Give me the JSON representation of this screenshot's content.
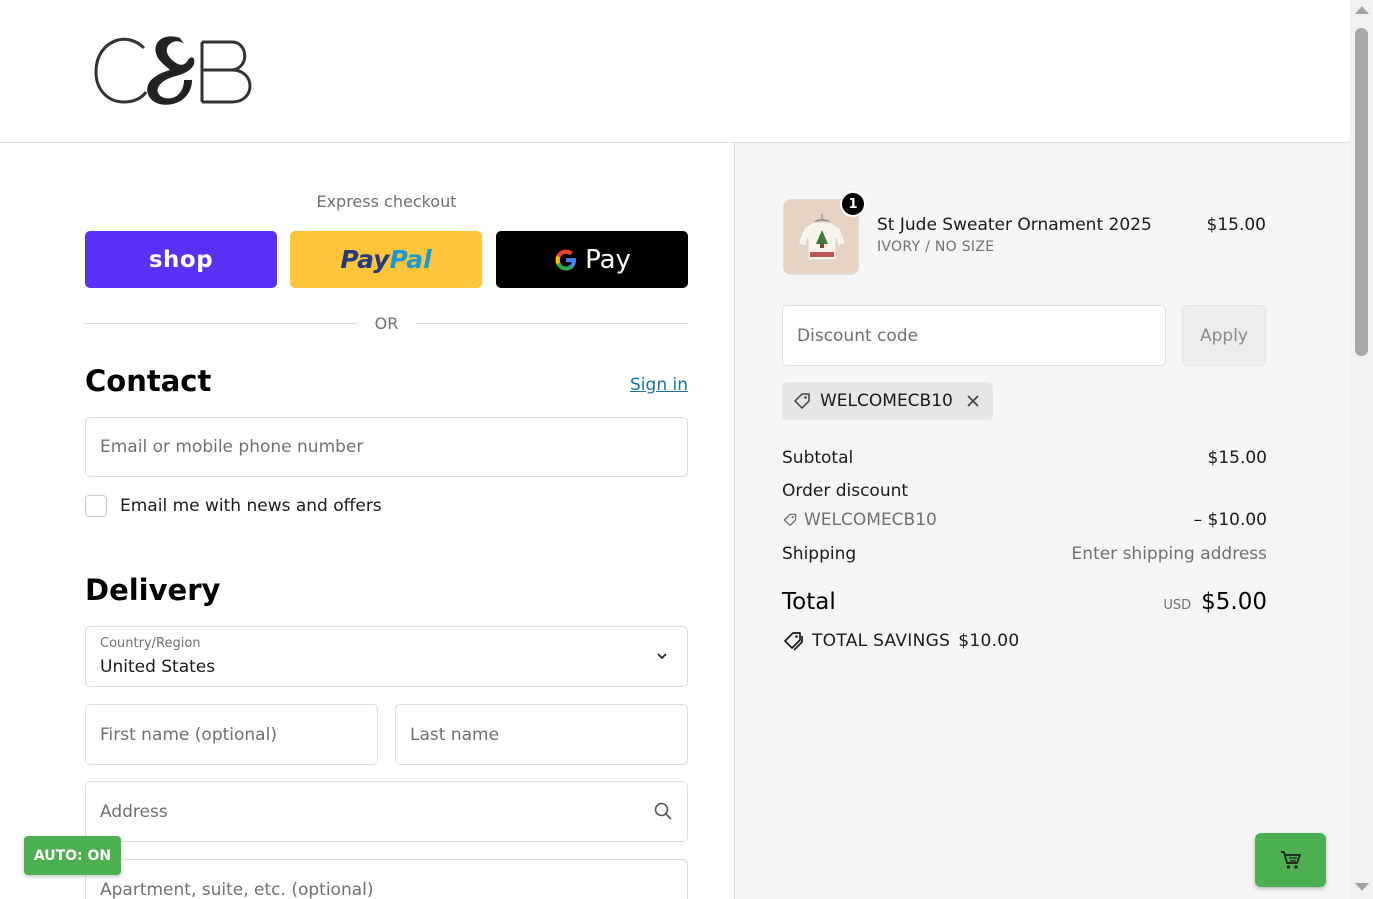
{
  "brand": {
    "logo_text": "C&B"
  },
  "express": {
    "label": "Express checkout",
    "shop_label": "shop",
    "paypal_part1": "Pay",
    "paypal_part2": "Pal",
    "gpay_g": "G",
    "gpay_label": "Pay",
    "or_label": "OR"
  },
  "contact": {
    "title": "Contact",
    "signin_label": "Sign in",
    "email_placeholder": "Email or mobile phone number",
    "newsletter_label": "Email me with news and offers",
    "newsletter_checked": false
  },
  "delivery": {
    "title": "Delivery",
    "country_label": "Country/Region",
    "country_value": "United States",
    "first_name_placeholder": "First name (optional)",
    "last_name_placeholder": "Last name",
    "address_placeholder": "Address",
    "apartment_placeholder": "Apartment, suite, etc. (optional)"
  },
  "order": {
    "item": {
      "quantity": "1",
      "name": "St Jude Sweater Ornament 2025",
      "variant": "IVORY / NO SIZE",
      "price": "$15.00"
    },
    "discount_placeholder": "Discount code",
    "apply_label": "Apply",
    "applied_code": "WELCOMECB10",
    "subtotal_label": "Subtotal",
    "subtotal_value": "$15.00",
    "order_discount_label": "Order discount",
    "discount_code": "WELCOMECB10",
    "discount_value": "– $10.00",
    "shipping_label": "Shipping",
    "shipping_value": "Enter shipping address",
    "total_label": "Total",
    "currency": "USD",
    "total_value": "$5.00",
    "savings_label": "TOTAL SAVINGS",
    "savings_value": "$10.00"
  },
  "overlay": {
    "auto_label": "AUTO: ON"
  },
  "colors": {
    "shop": "#5a31f4",
    "paypal": "#ffc439",
    "gpay": "#000000",
    "link": "#1773b0",
    "auto": "#4caf50"
  }
}
